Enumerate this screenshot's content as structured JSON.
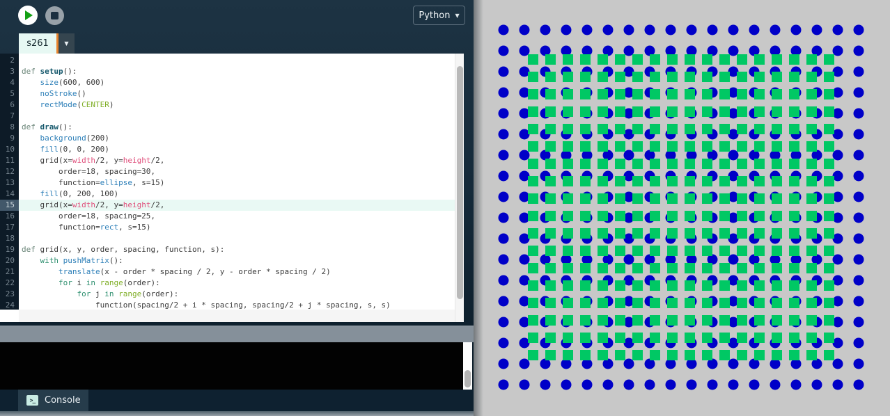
{
  "header": {
    "language_selector": {
      "label": "Python",
      "caret": "▼"
    }
  },
  "file_tabs": {
    "active_tab": "s261",
    "caret": "▼"
  },
  "editor": {
    "active_line": 15,
    "lines": [
      {
        "n": 2,
        "toks": []
      },
      {
        "n": 3,
        "toks": [
          [
            "kdef",
            "def "
          ],
          [
            "fn",
            "setup"
          ],
          [
            "pl",
            "():"
          ]
        ]
      },
      {
        "n": 4,
        "toks": [
          [
            "pl",
            "    "
          ],
          [
            "bi",
            "size"
          ],
          [
            "pl",
            "(600, 600)"
          ]
        ]
      },
      {
        "n": 5,
        "toks": [
          [
            "pl",
            "    "
          ],
          [
            "bi",
            "noStroke"
          ],
          [
            "pl",
            "()"
          ]
        ]
      },
      {
        "n": 6,
        "toks": [
          [
            "pl",
            "    "
          ],
          [
            "bi",
            "rectMode"
          ],
          [
            "pl",
            "("
          ],
          [
            "bg",
            "CENTER"
          ],
          [
            "pl",
            ")"
          ]
        ]
      },
      {
        "n": 7,
        "toks": []
      },
      {
        "n": 8,
        "toks": [
          [
            "kdef",
            "def "
          ],
          [
            "fn",
            "draw"
          ],
          [
            "pl",
            "():"
          ]
        ]
      },
      {
        "n": 9,
        "toks": [
          [
            "pl",
            "    "
          ],
          [
            "bi",
            "background"
          ],
          [
            "pl",
            "(200)"
          ]
        ]
      },
      {
        "n": 10,
        "toks": [
          [
            "pl",
            "    "
          ],
          [
            "bi",
            "fill"
          ],
          [
            "pl",
            "(0, 0, 200)"
          ]
        ]
      },
      {
        "n": 11,
        "toks": [
          [
            "pl",
            "    grid(x="
          ],
          [
            "vp",
            "width"
          ],
          [
            "pl",
            "/2, y="
          ],
          [
            "vp",
            "height"
          ],
          [
            "pl",
            "/2,"
          ]
        ]
      },
      {
        "n": 12,
        "toks": [
          [
            "pl",
            "        order=18, spacing=30,"
          ]
        ]
      },
      {
        "n": 13,
        "toks": [
          [
            "pl",
            "        function="
          ],
          [
            "bi",
            "ellipse"
          ],
          [
            "pl",
            ", s=15)"
          ]
        ]
      },
      {
        "n": 14,
        "toks": [
          [
            "pl",
            "    "
          ],
          [
            "bi",
            "fill"
          ],
          [
            "pl",
            "(0, 200, 100)"
          ]
        ]
      },
      {
        "n": 15,
        "toks": [
          [
            "pl",
            "    grid(x="
          ],
          [
            "vp",
            "width"
          ],
          [
            "pl",
            "/2, y="
          ],
          [
            "vp",
            "height"
          ],
          [
            "pl",
            "/2,"
          ]
        ]
      },
      {
        "n": 16,
        "toks": [
          [
            "pl",
            "        order=18, spacing=25,"
          ]
        ]
      },
      {
        "n": 17,
        "toks": [
          [
            "pl",
            "        function="
          ],
          [
            "bi",
            "rect"
          ],
          [
            "pl",
            ", s=15)"
          ]
        ]
      },
      {
        "n": 18,
        "toks": []
      },
      {
        "n": 19,
        "toks": [
          [
            "kdef",
            "def "
          ],
          [
            "pl",
            "grid(x, y, order, spacing, function, s):"
          ]
        ]
      },
      {
        "n": 20,
        "toks": [
          [
            "pl",
            "    "
          ],
          [
            "kw",
            "with"
          ],
          [
            "pl",
            " "
          ],
          [
            "bi",
            "pushMatrix"
          ],
          [
            "pl",
            "():"
          ]
        ]
      },
      {
        "n": 21,
        "toks": [
          [
            "pl",
            "        "
          ],
          [
            "bi",
            "translate"
          ],
          [
            "pl",
            "(x - order * spacing / 2, y - order * spacing / 2)"
          ]
        ]
      },
      {
        "n": 22,
        "toks": [
          [
            "pl",
            "        "
          ],
          [
            "kw",
            "for"
          ],
          [
            "pl",
            " i "
          ],
          [
            "kw",
            "in"
          ],
          [
            "pl",
            " "
          ],
          [
            "bg",
            "range"
          ],
          [
            "pl",
            "(order):"
          ]
        ]
      },
      {
        "n": 23,
        "toks": [
          [
            "pl",
            "            "
          ],
          [
            "kw",
            "for"
          ],
          [
            "pl",
            " j "
          ],
          [
            "kw",
            "in"
          ],
          [
            "pl",
            " "
          ],
          [
            "bg",
            "range"
          ],
          [
            "pl",
            "(order):"
          ]
        ]
      },
      {
        "n": 24,
        "toks": [
          [
            "pl",
            "                function(spacing/2 + i * spacing, spacing/2 + j * spacing, s, s)"
          ]
        ]
      }
    ]
  },
  "console_panel": {
    "tab_label": "Console",
    "icon_glyph": ">_"
  },
  "sketch_canvas": {
    "background": "#c8c8c8",
    "canvas_size": 600,
    "layers": [
      {
        "shape": "ellipse",
        "fill": "#0000c8",
        "order": 18,
        "spacing": 30,
        "size": 15
      },
      {
        "shape": "rect",
        "fill": "#00c864",
        "order": 18,
        "spacing": 25,
        "size": 15
      }
    ]
  },
  "colors": {
    "accent_orange": "#e8832c",
    "blue_fill": "#0000c8",
    "green_fill": "#00c864",
    "canvas_bg": "#c8c8c8"
  }
}
